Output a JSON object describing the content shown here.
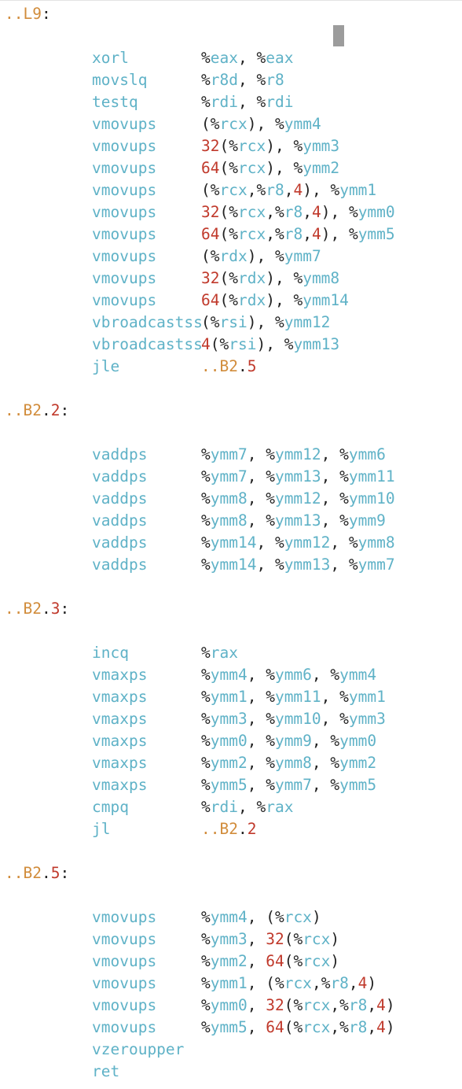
{
  "colors": {
    "mnemonic": "#5fb2c7",
    "register": "#5fb2c7",
    "label": "#d18c3b",
    "number": "#c0392b",
    "punctuation": "#222222",
    "cursor": "#9c9c9c"
  },
  "lines": [
    {
      "kind": "label",
      "text": "..L9:"
    },
    {
      "kind": "blank"
    },
    {
      "kind": "instr",
      "mnemonic": "xorl",
      "operands": "%eax, %eax"
    },
    {
      "kind": "instr",
      "mnemonic": "movslq",
      "operands": "%r8d, %r8"
    },
    {
      "kind": "instr",
      "mnemonic": "testq",
      "operands": "%rdi, %rdi"
    },
    {
      "kind": "instr",
      "mnemonic": "vmovups",
      "operands": "(%rcx), %ymm4"
    },
    {
      "kind": "instr",
      "mnemonic": "vmovups",
      "operands": "32(%rcx), %ymm3"
    },
    {
      "kind": "instr",
      "mnemonic": "vmovups",
      "operands": "64(%rcx), %ymm2"
    },
    {
      "kind": "instr",
      "mnemonic": "vmovups",
      "operands": "(%rcx,%r8,4), %ymm1"
    },
    {
      "kind": "instr",
      "mnemonic": "vmovups",
      "operands": "32(%rcx,%r8,4), %ymm0"
    },
    {
      "kind": "instr",
      "mnemonic": "vmovups",
      "operands": "64(%rcx,%r8,4), %ymm5"
    },
    {
      "kind": "instr",
      "mnemonic": "vmovups",
      "operands": "(%rdx), %ymm7"
    },
    {
      "kind": "instr",
      "mnemonic": "vmovups",
      "operands": "32(%rdx), %ymm8"
    },
    {
      "kind": "instr",
      "mnemonic": "vmovups",
      "operands": "64(%rdx), %ymm14"
    },
    {
      "kind": "instr",
      "mnemonic": "vbroadcastss",
      "operands": "(%rsi), %ymm12"
    },
    {
      "kind": "instr",
      "mnemonic": "vbroadcastss",
      "operands": "4(%rsi), %ymm13"
    },
    {
      "kind": "instr",
      "mnemonic": "jle",
      "operands": "..B2.5"
    },
    {
      "kind": "blank"
    },
    {
      "kind": "label",
      "text": "..B2.2:"
    },
    {
      "kind": "blank"
    },
    {
      "kind": "instr",
      "mnemonic": "vaddps",
      "operands": "%ymm7, %ymm12, %ymm6"
    },
    {
      "kind": "instr",
      "mnemonic": "vaddps",
      "operands": "%ymm7, %ymm13, %ymm11"
    },
    {
      "kind": "instr",
      "mnemonic": "vaddps",
      "operands": "%ymm8, %ymm12, %ymm10"
    },
    {
      "kind": "instr",
      "mnemonic": "vaddps",
      "operands": "%ymm8, %ymm13, %ymm9"
    },
    {
      "kind": "instr",
      "mnemonic": "vaddps",
      "operands": "%ymm14, %ymm12, %ymm8"
    },
    {
      "kind": "instr",
      "mnemonic": "vaddps",
      "operands": "%ymm14, %ymm13, %ymm7"
    },
    {
      "kind": "blank"
    },
    {
      "kind": "label",
      "text": "..B2.3:"
    },
    {
      "kind": "blank"
    },
    {
      "kind": "instr",
      "mnemonic": "incq",
      "operands": "%rax"
    },
    {
      "kind": "instr",
      "mnemonic": "vmaxps",
      "operands": "%ymm4, %ymm6, %ymm4"
    },
    {
      "kind": "instr",
      "mnemonic": "vmaxps",
      "operands": "%ymm1, %ymm11, %ymm1"
    },
    {
      "kind": "instr",
      "mnemonic": "vmaxps",
      "operands": "%ymm3, %ymm10, %ymm3"
    },
    {
      "kind": "instr",
      "mnemonic": "vmaxps",
      "operands": "%ymm0, %ymm9, %ymm0"
    },
    {
      "kind": "instr",
      "mnemonic": "vmaxps",
      "operands": "%ymm2, %ymm8, %ymm2"
    },
    {
      "kind": "instr",
      "mnemonic": "vmaxps",
      "operands": "%ymm5, %ymm7, %ymm5"
    },
    {
      "kind": "instr",
      "mnemonic": "cmpq",
      "operands": "%rdi, %rax"
    },
    {
      "kind": "instr",
      "mnemonic": "jl",
      "operands": "..B2.2"
    },
    {
      "kind": "blank"
    },
    {
      "kind": "label",
      "text": "..B2.5:"
    },
    {
      "kind": "blank"
    },
    {
      "kind": "instr",
      "mnemonic": "vmovups",
      "operands": "%ymm4, (%rcx)"
    },
    {
      "kind": "instr",
      "mnemonic": "vmovups",
      "operands": "%ymm3, 32(%rcx)"
    },
    {
      "kind": "instr",
      "mnemonic": "vmovups",
      "operands": "%ymm2, 64(%rcx)"
    },
    {
      "kind": "instr",
      "mnemonic": "vmovups",
      "operands": "%ymm1, (%rcx,%r8,4)"
    },
    {
      "kind": "instr",
      "mnemonic": "vmovups",
      "operands": "%ymm0, 32(%rcx,%r8,4)"
    },
    {
      "kind": "instr",
      "mnemonic": "vmovups",
      "operands": "%ymm5, 64(%rcx,%r8,4)"
    },
    {
      "kind": "instr",
      "mnemonic": "vzeroupper",
      "operands": ""
    },
    {
      "kind": "instr",
      "mnemonic": "ret",
      "operands": ""
    }
  ]
}
